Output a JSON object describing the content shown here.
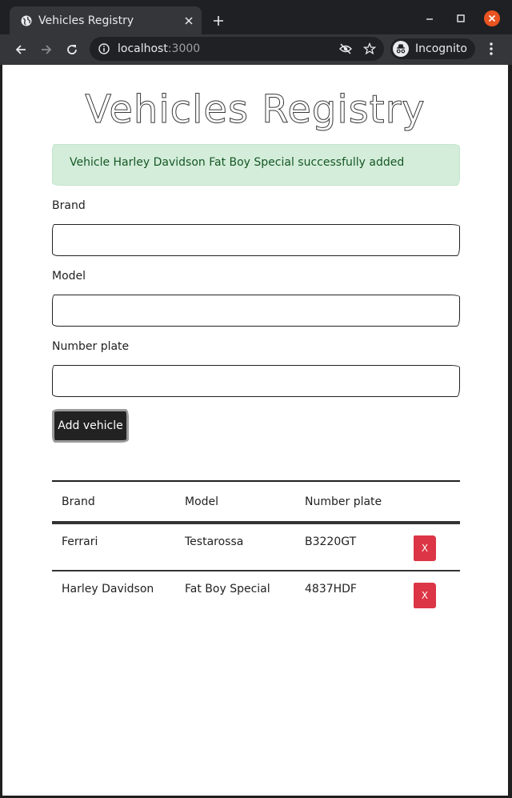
{
  "browser": {
    "tab_title": "Vehicles Registry",
    "url_host": "localhost",
    "url_port": ":3000",
    "incognito_label": "Incognito"
  },
  "page": {
    "title": "Vehicles Registry",
    "alert": "Vehicle Harley Davidson Fat Boy Special successfully added",
    "form": {
      "brand_label": "Brand",
      "brand_value": "",
      "model_label": "Model",
      "model_value": "",
      "plate_label": "Number plate",
      "plate_value": "",
      "submit_label": "Add vehicle"
    },
    "table": {
      "headers": [
        "Brand",
        "Model",
        "Number plate",
        ""
      ],
      "rows": [
        {
          "brand": "Ferrari",
          "model": "Testarossa",
          "plate": "B3220GT",
          "action": "X"
        },
        {
          "brand": "Harley Davidson",
          "model": "Fat Boy Special",
          "plate": "4837HDF",
          "action": "X"
        }
      ]
    }
  },
  "colors": {
    "alert_bg": "#d4edda",
    "alert_text": "#155724",
    "delete_button": "#dc3545",
    "primary_button": "#222222",
    "window_close": "#e95420"
  }
}
